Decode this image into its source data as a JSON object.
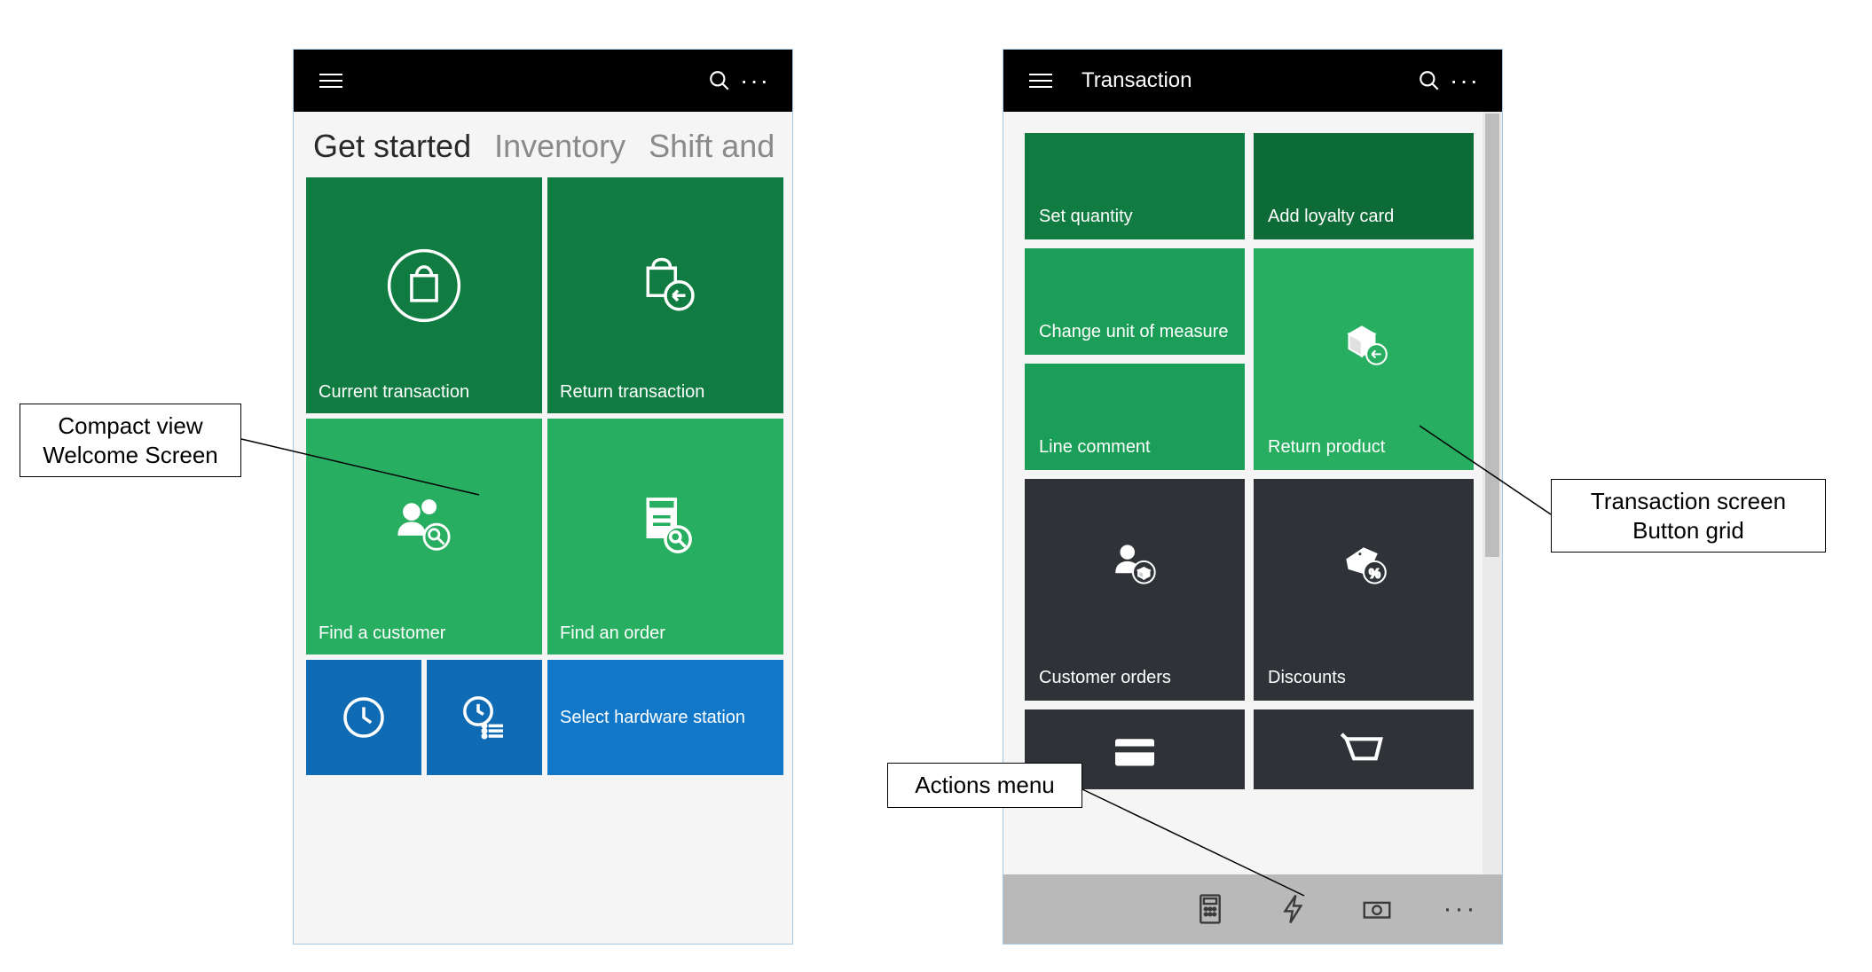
{
  "leftPhone": {
    "title": "",
    "tabs": [
      {
        "label": "Get started",
        "active": true
      },
      {
        "label": "Inventory",
        "active": false
      },
      {
        "label": "Shift and",
        "active": false
      }
    ],
    "tiles": {
      "currentTransaction": "Current transaction",
      "returnTransaction": "Return transaction",
      "findCustomer": "Find a customer",
      "findOrder": "Find an order",
      "selectHardware": "Select hardware station"
    }
  },
  "rightPhone": {
    "title": "Transaction",
    "tiles": {
      "setQuantity": "Set quantity",
      "addLoyalty": "Add loyalty card",
      "changeUOM": "Change unit of measure",
      "lineComment": "Line comment",
      "returnProduct": "Return product",
      "customerOrders": "Customer orders",
      "discounts": "Discounts"
    },
    "actionBarIcons": {
      "calculator": "calculator-icon",
      "lightning": "lightning-icon",
      "cash": "cash-icon",
      "more": "more-icon"
    }
  },
  "callouts": {
    "welcome": "Compact view Welcome Screen",
    "buttonGrid": "Transaction screen Button grid",
    "actionsMenu": "Actions menu"
  },
  "colors": {
    "headerBg": "#000000",
    "darkGreen": "#107c41",
    "green": "#27ae60",
    "blue": "#0f6bb4",
    "dark": "#2f3338",
    "actionBar": "#b9b9b9"
  }
}
